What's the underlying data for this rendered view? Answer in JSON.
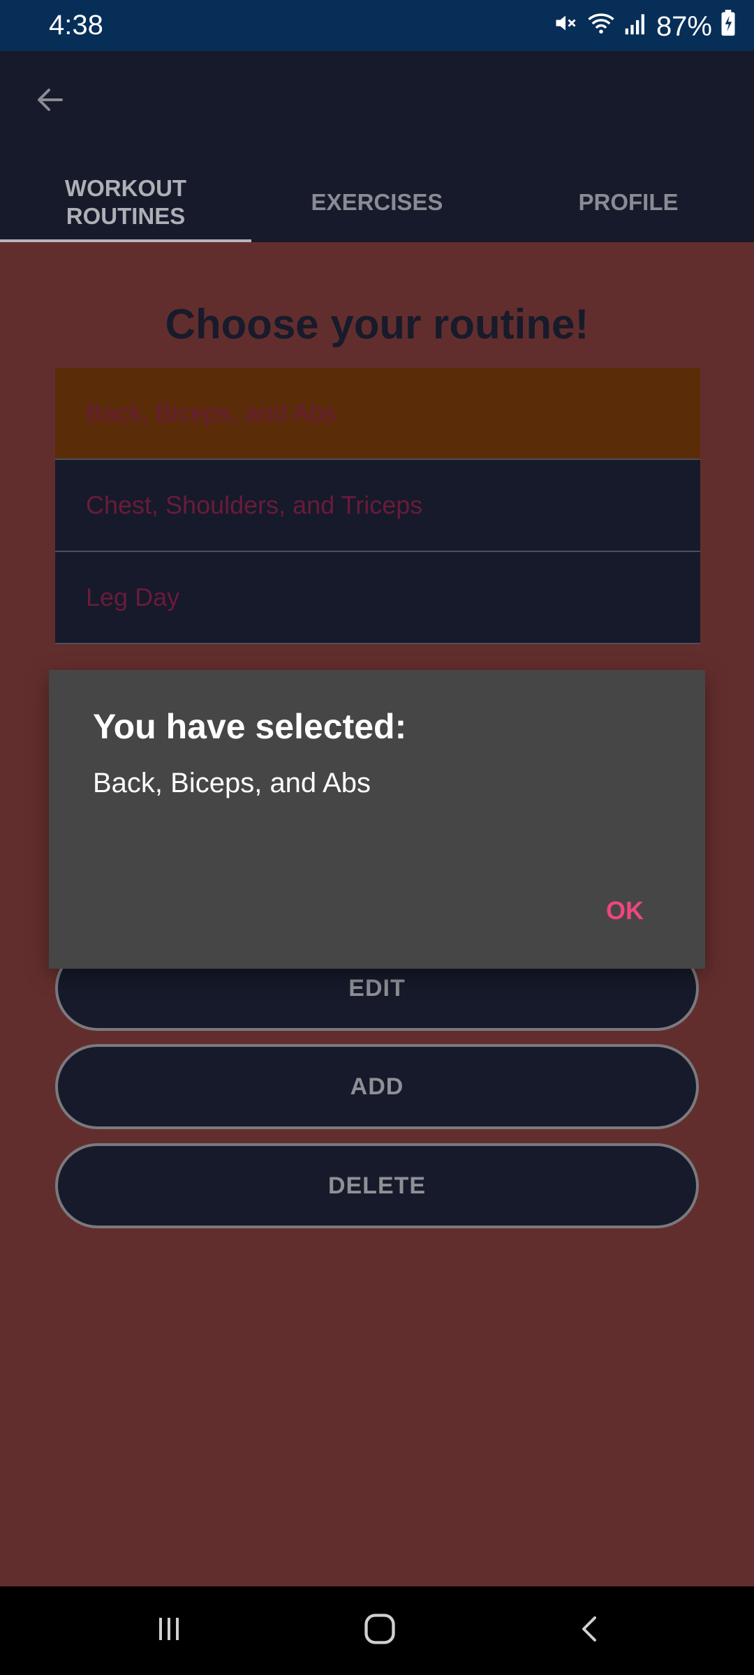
{
  "status_bar": {
    "time": "4:38",
    "battery": "87%"
  },
  "app_bar": {
    "tabs": [
      {
        "label": "WORKOUT\nROUTINES",
        "active": true
      },
      {
        "label": "EXERCISES",
        "active": false
      },
      {
        "label": "PROFILE",
        "active": false
      }
    ]
  },
  "main": {
    "heading": "Choose your routine!",
    "routines": [
      {
        "label": "Back, Biceps, and Abs",
        "selected": true
      },
      {
        "label": "Chest, Shoulders, and Triceps",
        "selected": false
      },
      {
        "label": "Leg Day",
        "selected": false
      }
    ],
    "buttons": {
      "edit": "EDIT",
      "add": "ADD",
      "delete": "DELETE"
    }
  },
  "dialog": {
    "title": "You have selected:",
    "message": "Back, Biceps, and Abs",
    "ok_label": "OK"
  },
  "colors": {
    "background": "#622e2d",
    "app_bar": "#161a2a",
    "selected_row": "#5b2c08",
    "accent": "#f0457e",
    "status_bar": "#072e57"
  },
  "icons": [
    "back-arrow-icon",
    "mute-icon",
    "wifi-icon",
    "signal-icon",
    "battery-charging-icon",
    "recents-icon",
    "home-icon",
    "nav-back-icon"
  ]
}
